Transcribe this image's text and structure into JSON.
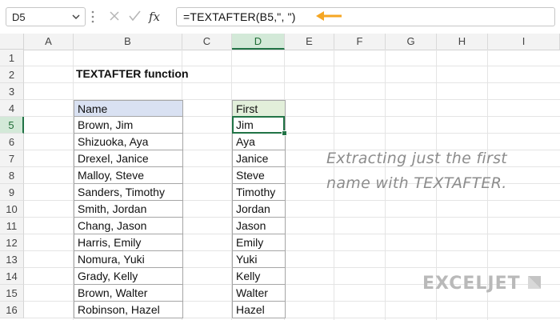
{
  "formula_bar": {
    "name_box": "D5",
    "formula": "=TEXTAFTER(B5,\", \")"
  },
  "columns": [
    "A",
    "B",
    "C",
    "D",
    "E",
    "F",
    "G",
    "H",
    "I"
  ],
  "rows": [
    "1",
    "2",
    "3",
    "4",
    "5",
    "6",
    "7",
    "8",
    "9",
    "10",
    "11",
    "12",
    "13",
    "14",
    "15",
    "16"
  ],
  "selected_column": "D",
  "selected_row": "5",
  "sheet": {
    "title": "TEXTAFTER function",
    "name_header": "Name",
    "first_header": "First",
    "names": [
      "Brown, Jim",
      "Shizuoka, Aya",
      "Drexel, Janice",
      "Malloy, Steve",
      "Sanders, Timothy",
      "Smith, Jordan",
      "Chang, Jason",
      "Harris, Emily",
      "Nomura, Yuki",
      "Grady, Kelly",
      "Brown, Walter",
      "Robinson, Hazel"
    ],
    "firsts": [
      "Jim",
      "Aya",
      "Janice",
      "Steve",
      "Timothy",
      "Jordan",
      "Jason",
      "Emily",
      "Yuki",
      "Kelly",
      "Walter",
      "Hazel"
    ]
  },
  "note": {
    "line1": "Extracting just the first",
    "line2": "name with TEXTAFTER."
  },
  "logo": {
    "text": "EXCELJET"
  },
  "icons": {
    "cancel": "x-icon",
    "enter": "check-icon",
    "function": "fx-icon",
    "arrow": "left-arrow-icon"
  },
  "colors": {
    "selection": "#217346",
    "name_header_fill": "#d9e1f2",
    "first_header_fill": "#e2efda",
    "arrow": "#f5a623"
  }
}
